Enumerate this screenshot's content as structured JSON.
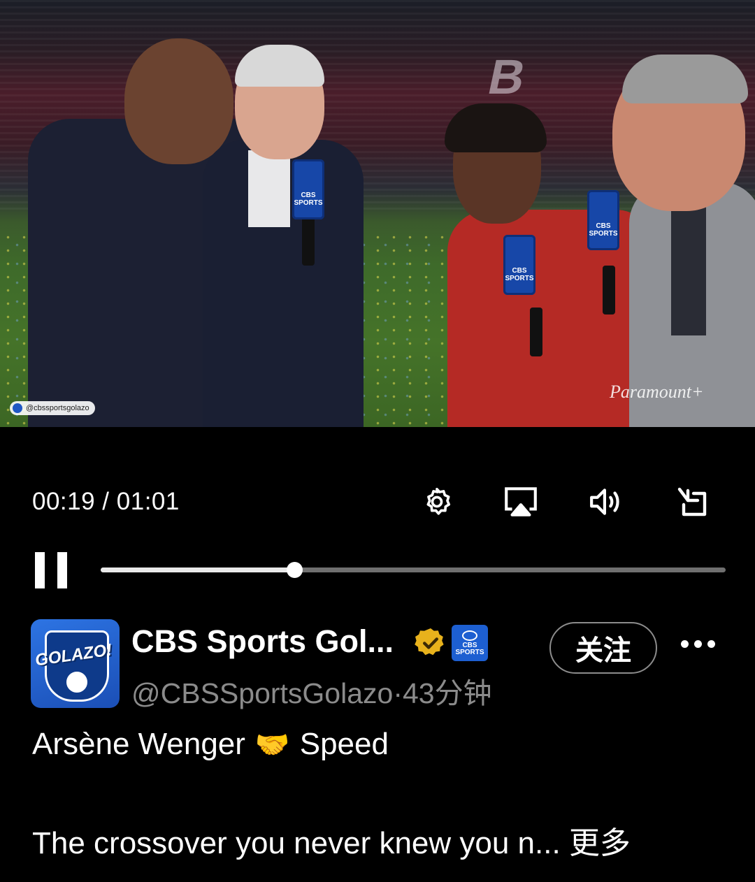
{
  "video": {
    "handle_watermark": "@cbssportsgolazo",
    "brand_watermark": "Paramount+",
    "mic_label": "CBS SPORTS",
    "stadium_text": "B"
  },
  "player": {
    "time_display": "00:19 / 01:01",
    "progress": 0.31,
    "icons": [
      "gear-icon",
      "airplay-icon",
      "volume-icon",
      "minimize-icon",
      "pause-icon"
    ]
  },
  "tweet": {
    "display_name": "CBS Sports Gol...",
    "affiliate_label": "CBS SPORTS",
    "handle": "@CBSSportsGolazo",
    "separator": "·",
    "time_ago": "43分钟",
    "follow_label": "关注",
    "avatar_text": "GOLAZO!",
    "text_part1": "Arsène Wenger",
    "emoji": "🤝",
    "text_part2": "Speed",
    "text_line2": "The crossover you never knew you n...",
    "show_more": "更多"
  },
  "colors": {
    "background": "#000000",
    "verified_gold": "#e8b21c",
    "brand_blue": "#1d5fd1",
    "muted_text": "#8b8b8b"
  }
}
